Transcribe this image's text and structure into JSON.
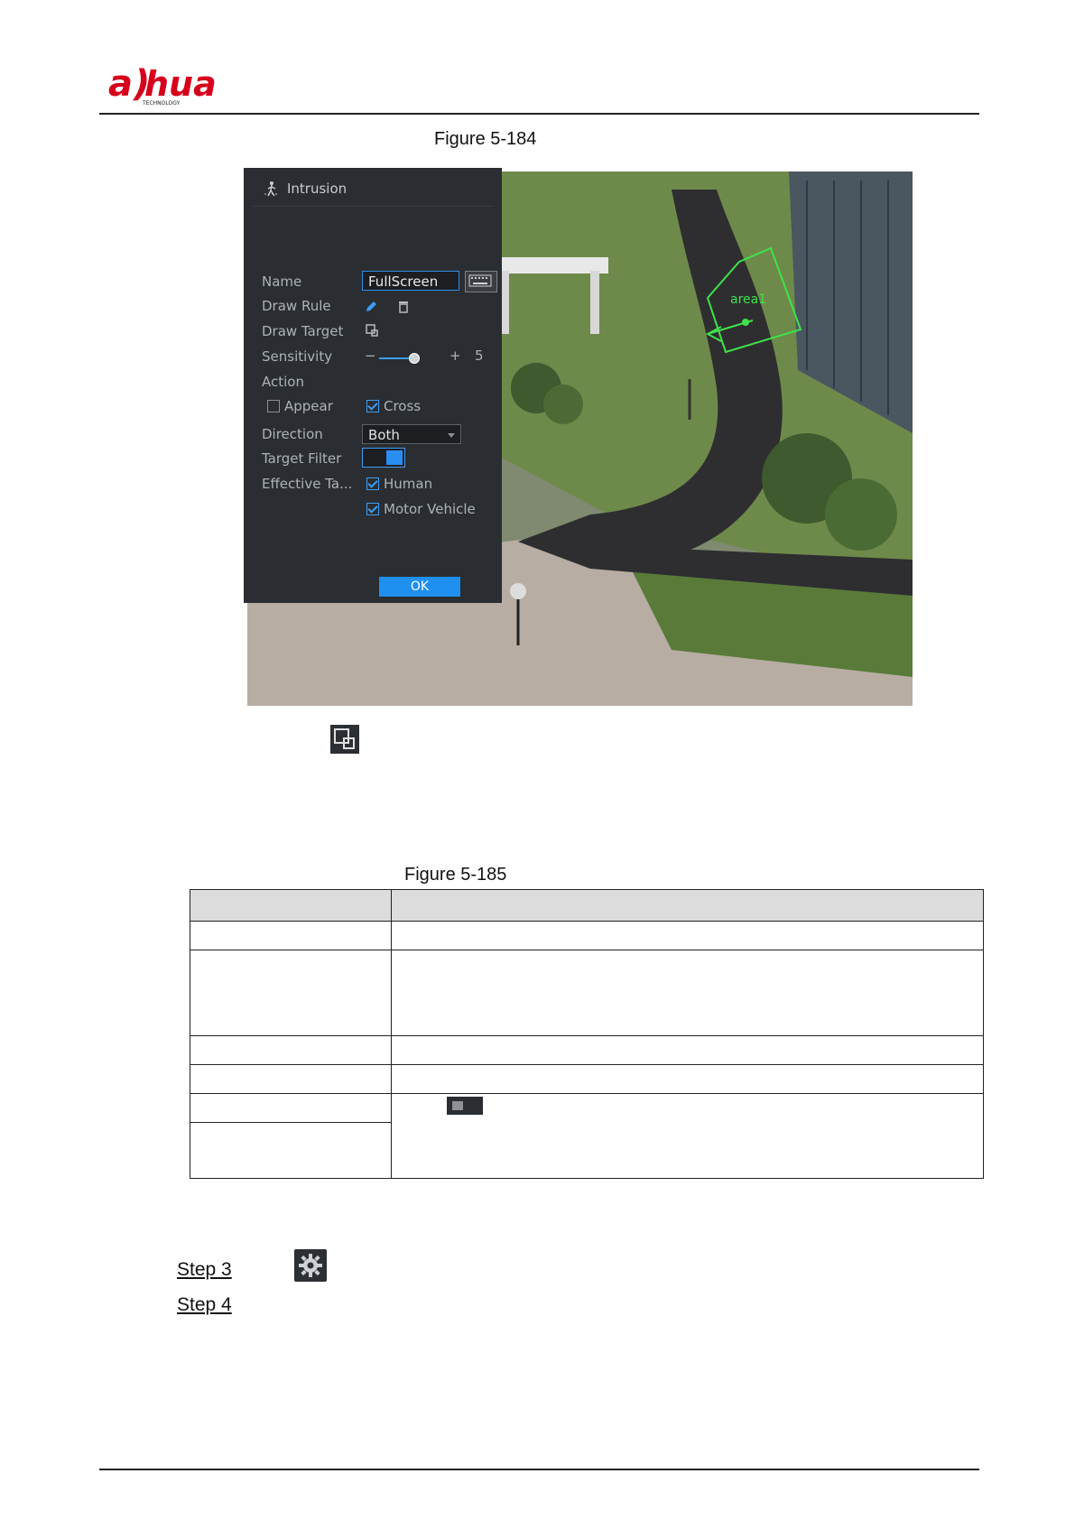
{
  "header": {
    "logo_text": "alhua",
    "logo_subtext": "TECHNOLOGY"
  },
  "figure_1": {
    "caption": "Figure 5-184",
    "panel": {
      "title": "Intrusion",
      "fields": {
        "name_label": "Name",
        "name_value": "FullScreen",
        "draw_rule_label": "Draw Rule",
        "draw_target_label": "Draw Target",
        "sensitivity_label": "Sensitivity",
        "sensitivity_minus": "−",
        "sensitivity_plus": "+",
        "sensitivity_value": "5",
        "action_label": "Action",
        "appear_label": "Appear",
        "cross_label": "Cross",
        "direction_label": "Direction",
        "direction_value": "Both",
        "target_filter_label": "Target Filter",
        "effective_target_label": "Effective Ta...",
        "human_label": "Human",
        "motor_vehicle_label": "Motor Vehicle",
        "ok_label": "OK"
      },
      "states": {
        "appear_checked": false,
        "cross_checked": true,
        "human_checked": true,
        "motor_vehicle_checked": true,
        "target_filter_on": true
      }
    },
    "overlay_area_label": "area1"
  },
  "figure_2": {
    "caption": "Figure 5-185"
  },
  "steps": {
    "step3": "Step 3",
    "step4": "Step 4"
  },
  "colors": {
    "accent": "#1f8ff0",
    "panel_bg": "#2a2d31",
    "area_outline": "#3ee24a"
  }
}
